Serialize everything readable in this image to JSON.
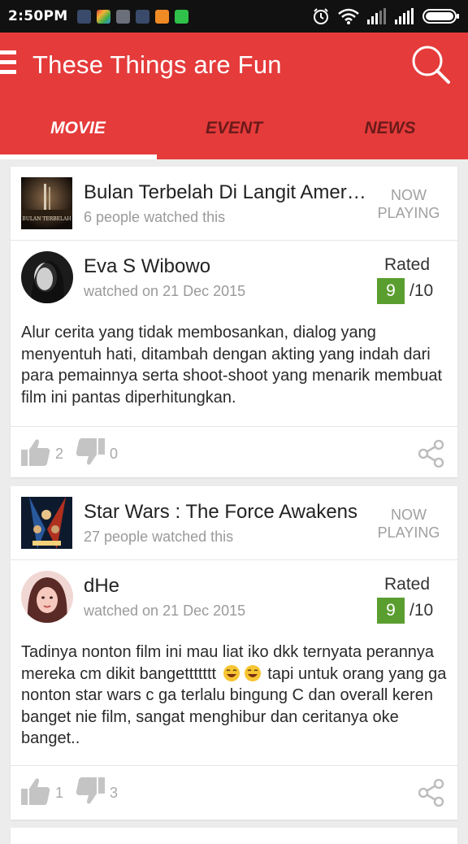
{
  "status_bar": {
    "time": "2:50PM",
    "notification_icons": [
      "bbm-icon",
      "colorful-app-icon",
      "settings-app-icon",
      "bbm-icon",
      "camera-app-icon",
      "line-icon"
    ],
    "system_icons": [
      "alarm-icon",
      "wifi-icon",
      "signal-icon",
      "signal-icon",
      "battery-icon"
    ]
  },
  "app_bar": {
    "title": "These Things are Fun",
    "background": "#e53b3b"
  },
  "tabs": [
    {
      "label": "MOVIE",
      "active": true
    },
    {
      "label": "EVENT",
      "active": false
    },
    {
      "label": "NEWS",
      "active": false
    }
  ],
  "cards": [
    {
      "movie_title": "Bulan Terbelah Di Langit Amerika",
      "watched_count": "6 people watched this",
      "status_line1": "NOW",
      "status_line2": "PLAYING",
      "poster_text": "BULAN TERBELAH",
      "user": "Eva S Wibowo",
      "watched_on": "watched on 21 Dec 2015",
      "rated_label": "Rated",
      "rating": "9",
      "rating_max": "/10",
      "review": "Alur cerita yang tidak membosankan, dialog yang menyentuh hati, ditambah dengan akting yang indah dari para pemainnya serta shoot-shoot yang menarik membuat film ini pantas diperhitungkan.",
      "likes": "2",
      "dislikes": "0"
    },
    {
      "movie_title": "Star Wars : The Force Awakens",
      "watched_count": "27 people watched this",
      "status_line1": "NOW",
      "status_line2": "PLAYING",
      "user": "dHe",
      "watched_on": "watched on 21 Dec 2015",
      "rated_label": "Rated",
      "rating": "9",
      "rating_max": "/10",
      "review_part1": "Tadinya nonton film ini mau liat iko dkk ternyata perannya mereka cm dikit bangettttttt",
      "review_emoji": "laughing-emoji",
      "review_part2": "tapi untuk orang yang ga  nonton star wars c ga terlalu bingung C dan overall keren banget nie film, sangat menghibur dan ceritanya oke banget..",
      "likes": "1",
      "dislikes": "3"
    }
  ],
  "colors": {
    "accent": "#e53b3b",
    "rating": "#5a9e2f",
    "muted_text": "#9a9a9a"
  }
}
